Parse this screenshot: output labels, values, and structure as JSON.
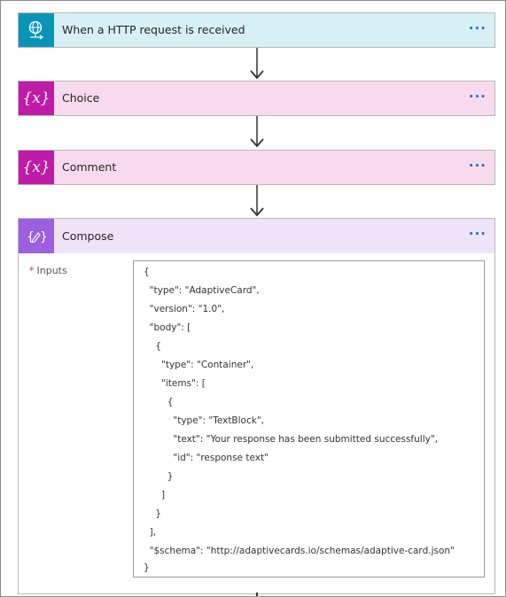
{
  "steps": [
    {
      "title": "When a HTTP request is received",
      "icon": "globe-request-icon",
      "color": "#0a95b8",
      "bg": "#d6f0f6"
    },
    {
      "title": "Choice",
      "icon": "variable-icon",
      "color": "#c01ba8",
      "bg": "#f8daef"
    },
    {
      "title": "Comment",
      "icon": "variable-icon",
      "color": "#c01ba8",
      "bg": "#f8daef"
    }
  ],
  "compose": {
    "title": "Compose",
    "icon": "compose-icon",
    "color": "#9b5fe0",
    "inputs_label": "Inputs",
    "required_marker": "*",
    "code_lines": [
      "{",
      "  \"type\": \"AdaptiveCard\",",
      "  \"version\": \"1.0\",",
      "  \"body\": [",
      "    {",
      "      \"type\": \"Container\",",
      "      \"items\": [",
      "        {",
      "          \"type\": \"TextBlock\",",
      "          \"text\": \"Your response has been submitted successfully\",",
      "          \"id\": \"response text\"",
      "        }",
      "      ]",
      "    }",
      "  ],",
      "  \"$schema\": \"http://adaptivecards.io/schemas/adaptive-card.json\"",
      "}"
    ]
  },
  "more_label": "···",
  "variable_glyph": "{x}",
  "compose_glyph": "{✎}"
}
